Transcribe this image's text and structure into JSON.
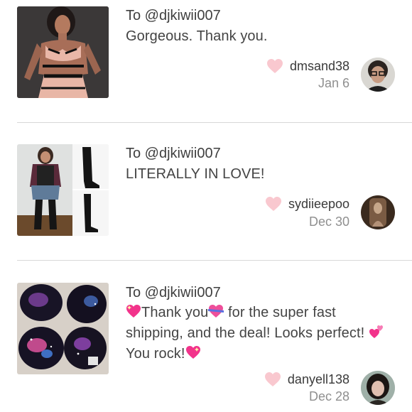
{
  "reviews": [
    {
      "to": "To @djkiwii007",
      "message_text": "Gorgeous. Thank you.",
      "username": "dmsand38",
      "date": "Jan 6",
      "thumb_icon": "lingerie-photo",
      "avatar_icon": "user-avatar-glasses"
    },
    {
      "to": "To @djkiwii007",
      "message_text": "LITERALLY IN LOVE!",
      "username": "sydiieepoo",
      "date": "Dec 30",
      "thumb_icon": "outfit-and-boots-photo",
      "avatar_icon": "user-avatar-brown"
    },
    {
      "to": "To @djkiwii007",
      "message_parts": {
        "p1": "Thank you",
        "p2": " for the super fast shipping, and the deal! Looks perfect! ",
        "p3": "You rock!"
      },
      "username": "danyell138",
      "date": "Dec 28",
      "thumb_icon": "galaxy-bras-photo",
      "avatar_icon": "user-avatar-woman"
    }
  ],
  "colors": {
    "heart": "#f9c8cf",
    "divider": "#d8d8d8",
    "date": "#8f8f8f"
  }
}
